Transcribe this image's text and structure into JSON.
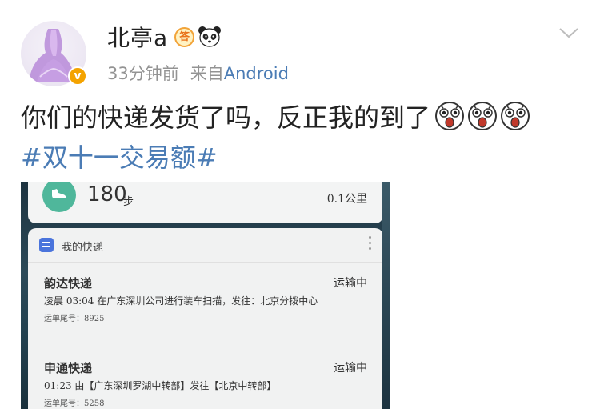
{
  "post": {
    "username": "北亭a",
    "badge_text": "答",
    "verify_text": "v",
    "time": "33分钟前",
    "source_prefix": "来自",
    "source": "Android",
    "text": "你们的快递发货了吗，反正我的到了",
    "hashtag": "#双十一交易额#"
  },
  "icons": {
    "badge": "answer-badge-icon",
    "panda": "panda-icon",
    "emoji": "shocked-face-emoji",
    "chevron": "chevron-down-icon",
    "shoe": "shoe-icon",
    "app": "express-app-icon",
    "more": "more-vertical-icon"
  },
  "colors": {
    "link": "#4b7cb5",
    "meta": "#939393",
    "verify": "#f4a300",
    "steps": "#4fb79b",
    "app_icon": "#4a74dc"
  },
  "screenshot": {
    "steps": {
      "count": "180",
      "unit": "步",
      "distance": "0.1公里"
    },
    "express": {
      "title": "我的快递",
      "packages": [
        {
          "carrier": "韵达快递",
          "status": "运输中",
          "detail": "凌晨 03:04 在广东深圳公司进行装车扫描，发往：北京分拨中心",
          "tracking": "运单尾号：8925"
        },
        {
          "carrier": "申通快递",
          "status": "运输中",
          "detail": "01:23 由【广东深圳罗湖中转部】发往【北京中转部】",
          "tracking": "运单尾号：5258"
        }
      ]
    }
  }
}
